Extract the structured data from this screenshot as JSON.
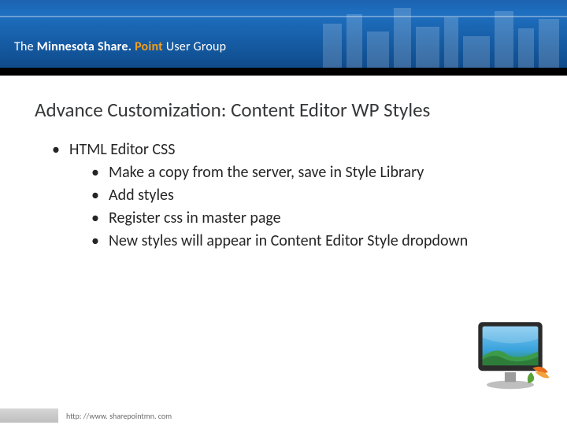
{
  "header": {
    "brand_prefix": "The",
    "brand_state": "Minnesota",
    "brand_product_a": "Share.",
    "brand_product_b": "Point",
    "brand_suffix": "User Group"
  },
  "slide": {
    "title": "Advance Customization: Content Editor WP Styles",
    "bullet_top": "HTML Editor CSS",
    "sub": [
      "Make a copy from the server, save in Style Library",
      "Add styles",
      "Register css in master page",
      "New styles will appear in  Content Editor Style dropdown"
    ]
  },
  "footer": {
    "url": "http: //www. sharepointmn. com"
  },
  "icons": {
    "monitor": "monitor-clipart-icon"
  }
}
